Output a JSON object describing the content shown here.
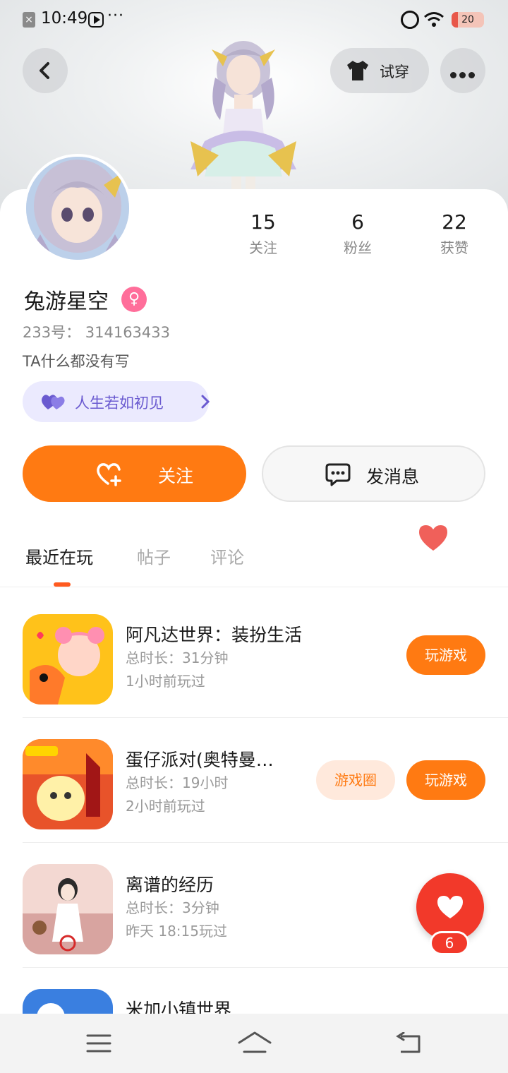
{
  "status_bar": {
    "time": "10:49",
    "more": "···",
    "battery": "20"
  },
  "header": {
    "try_on_label": "试穿"
  },
  "profile": {
    "name": "兔游星空",
    "gender_symbol": "♀",
    "uid": "233号： 314163433",
    "bio": "TA什么都没有写",
    "tag": "人生若如初见",
    "stats": [
      {
        "value": "15",
        "label": "关注"
      },
      {
        "value": "6",
        "label": "粉丝"
      },
      {
        "value": "22",
        "label": "获赞"
      }
    ]
  },
  "actions": {
    "follow": "关注",
    "message": "发消息"
  },
  "tabs": [
    "最近在玩",
    "帖子",
    "评论"
  ],
  "games": [
    {
      "title": "阿凡达世界：装扮生活",
      "duration": "总时长：31分钟",
      "last_played": "1小时前玩过",
      "play": "玩游戏"
    },
    {
      "title": "蛋仔派对(奥特曼…",
      "duration": "总时长：19小时",
      "last_played": "2小时前玩过",
      "circle": "游戏圈",
      "play": "玩游戏"
    },
    {
      "title": "离谱的经历",
      "duration": "总时长：3分钟",
      "last_played": "昨天 18:15玩过"
    },
    {
      "title": "米加小镇世界"
    }
  ],
  "fab": {
    "count": "6"
  },
  "colors": {
    "accent": "#ff7a12",
    "fab": "#f2392a",
    "tag_bg": "#ebeafe",
    "tag_text": "#6a5ad0"
  }
}
